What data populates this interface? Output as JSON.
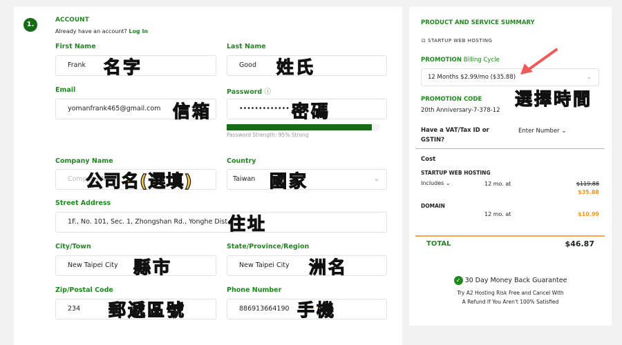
{
  "account": {
    "step": "1.",
    "title": "ACCOUNT",
    "login_prompt": "Already have an account?",
    "login_link": "Log In"
  },
  "fields": {
    "first_name": {
      "label": "First Name",
      "value": "Frank",
      "note": "名字"
    },
    "last_name": {
      "label": "Last Name",
      "value": "Good",
      "note": "姓氏"
    },
    "email": {
      "label": "Email",
      "value": "yomanfrank465@gmail.com",
      "note": "信箱"
    },
    "password": {
      "label": "Password",
      "value": "•••••••••••••",
      "note": "密碼",
      "strength_text": "Password Strength: 95% Strong",
      "strength": 95
    },
    "company": {
      "label": "Company Name",
      "placeholder": "Company Name",
      "note": "公司名(選填)"
    },
    "country": {
      "label": "Country",
      "value": "Taiwan",
      "note": "國家"
    },
    "street": {
      "label": "Street Address",
      "value": "1F., No. 101, Sec. 1, Zhongshan Rd., Yonghe Dist.",
      "note": "住址"
    },
    "city": {
      "label": "City/Town",
      "value": "New Taipei City",
      "note": "縣市"
    },
    "state": {
      "label": "State/Province/Region",
      "value": "New Taipei City",
      "note": "洲名"
    },
    "zip": {
      "label": "Zip/Postal Code",
      "value": "234",
      "note": "郵遞區號"
    },
    "phone": {
      "label": "Phone Number",
      "value": "886913664190",
      "note": "手機"
    }
  },
  "summary": {
    "title": "PRODUCT AND SERVICE SUMMARY",
    "product": "STARTUP WEB HOSTING",
    "billing_label_bold": "PROMOTION",
    "billing_label": "Billing Cycle",
    "billing_value": "12 Months $2.99/mo ($35.88)",
    "billing_note": "選擇時間",
    "promo_label": "PROMOTION CODE",
    "promo_value": "20th Anniversary-7-378-12",
    "vat_label": "Have a VAT/Tax ID or GSTIN?",
    "vat_button": "Enter Number",
    "cost": "Cost",
    "items": [
      {
        "name": "STARTUP WEB HOSTING",
        "includes": "Includes",
        "term": "12 mo. at",
        "old_price": "$119.88",
        "price": "$35.88"
      },
      {
        "name": "DOMAIN",
        "term": "12 mo. at",
        "price": "$10.99"
      }
    ],
    "total_label": "TOTAL",
    "total": "$46.87",
    "guarantee": "30 Day Money Back Guarantee",
    "guarantee_line1": "Try A2 Hosting Risk Free and Cancel With",
    "guarantee_line2": "A Refund If You Aren't 100% Satisfied"
  },
  "colors": {
    "green": "#1e8a1e",
    "orange": "#f7941d",
    "arrow": "#f05a5a"
  }
}
